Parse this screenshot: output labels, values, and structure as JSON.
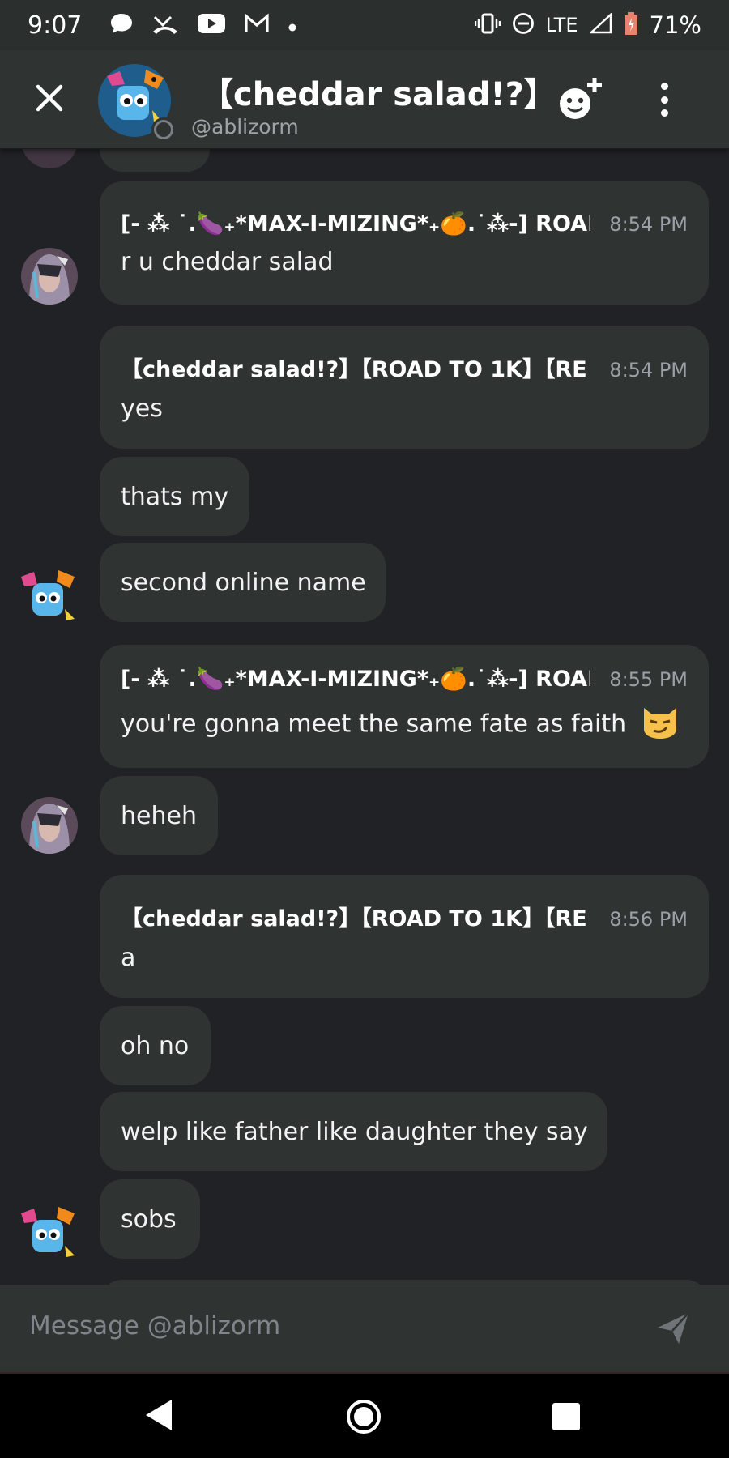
{
  "status_bar": {
    "time": "9:07",
    "lte_label": "LTE",
    "battery": "71%",
    "left_icons": [
      "chat-bubble-icon",
      "missed-call-icon",
      "youtube-icon",
      "gmail-icon",
      "dot-icon"
    ],
    "right_icons": [
      "vibrate-icon",
      "do-not-disturb-icon",
      "signal-icon",
      "battery-icon"
    ]
  },
  "header": {
    "title": "【cheddar salad!?】",
    "username": "@ablizorm"
  },
  "messages": [
    {
      "author": "[- ⁂ ˙.🍆₊*MAX-I-MIZING*₊🍊.˙⁂-] ROAD",
      "time": "8:54 PM",
      "text": "r u cheddar salad"
    },
    {
      "author": "【cheddar salad!?】【ROAD TO 1K】【RE",
      "time": "8:54 PM",
      "text": "yes"
    },
    {
      "text": "thats my"
    },
    {
      "text": "second online name"
    },
    {
      "author": "[- ⁂ ˙.🍆₊*MAX-I-MIZING*₊🍊.˙⁂-] ROAD",
      "time": "8:55 PM",
      "text": "you're gonna meet the same fate as faith"
    },
    {
      "text": "heheh"
    },
    {
      "author": "【cheddar salad!?】【ROAD TO 1K】【RE",
      "time": "8:56 PM",
      "text": "a"
    },
    {
      "text": "oh no"
    },
    {
      "text": "welp like father like daughter they say"
    },
    {
      "text": "sobs"
    }
  ],
  "composer": {
    "placeholder": "Message @ablizorm"
  },
  "colors": {
    "background": "#202225",
    "bubble": "#2f3331",
    "header": "#2f3331",
    "muted_text": "#9aa0a6"
  }
}
